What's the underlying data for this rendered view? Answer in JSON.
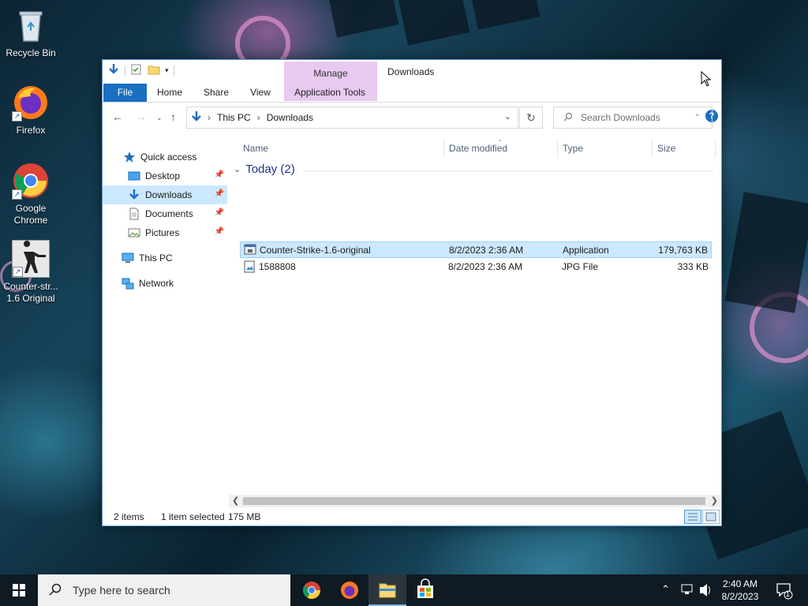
{
  "desktop": {
    "icons": [
      {
        "label": "Recycle Bin",
        "icon": "recycle-bin-icon"
      },
      {
        "label": "Firefox",
        "icon": "firefox-icon"
      },
      {
        "label": "Google Chrome",
        "icon": "chrome-icon"
      },
      {
        "label": "Counter-str... 1.6 Original",
        "icon": "counter-strike-icon"
      }
    ]
  },
  "explorer": {
    "title": "Downloads",
    "contextual_tab_group": "Manage",
    "ribbon_tabs": [
      {
        "label": "File"
      },
      {
        "label": "Home"
      },
      {
        "label": "Share"
      },
      {
        "label": "View"
      },
      {
        "label": "Application Tools"
      }
    ],
    "breadcrumb": [
      "This PC",
      "Downloads"
    ],
    "search_placeholder": "Search Downloads",
    "nav_pane": [
      {
        "label": "Quick access",
        "icon": "star-icon"
      },
      {
        "label": "Desktop",
        "icon": "desktop-folder-icon",
        "pinned": true
      },
      {
        "label": "Downloads",
        "icon": "download-arrow-icon",
        "pinned": true,
        "selected": true
      },
      {
        "label": "Documents",
        "icon": "document-icon",
        "pinned": true
      },
      {
        "label": "Pictures",
        "icon": "pictures-icon",
        "pinned": true
      },
      {
        "label": "This PC",
        "icon": "computer-icon"
      },
      {
        "label": "Network",
        "icon": "network-icon"
      }
    ],
    "columns": [
      "Name",
      "Date modified",
      "Type",
      "Size"
    ],
    "group": {
      "label": "Today (2)"
    },
    "files": [
      {
        "name": "Counter-Strike-1.6-original",
        "date": "8/2/2023 2:36 AM",
        "type": "Application",
        "size": "179,763 KB",
        "icon": "application-icon",
        "selected": true
      },
      {
        "name": "1588808",
        "date": "8/2/2023 2:36 AM",
        "type": "JPG File",
        "size": "333 KB",
        "icon": "image-file-icon",
        "selected": false
      }
    ],
    "status": {
      "items": "2 items",
      "selected": "1 item selected",
      "size": "175 MB"
    }
  },
  "taskbar": {
    "search_placeholder": "Type here to search",
    "apps": [
      "chrome-icon",
      "firefox-icon",
      "file-explorer-icon",
      "store-icon"
    ],
    "clock": {
      "time": "2:40 AM",
      "date": "8/2/2023"
    },
    "notification_count": "1"
  }
}
